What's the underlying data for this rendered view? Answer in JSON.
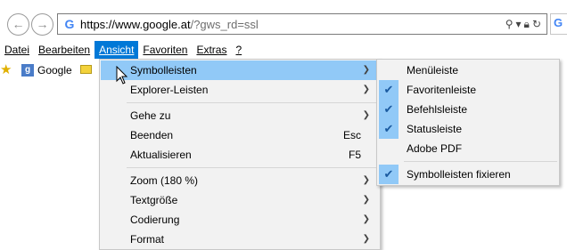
{
  "address_bar": {
    "url_host": "https://www.google.at",
    "url_path": "/?gws_rd=ssl",
    "icons": [
      "search-icon",
      "dropdown-icon",
      "lock-icon",
      "refresh-icon"
    ]
  },
  "nav": {
    "back_glyph": "←",
    "forward_glyph": "→"
  },
  "menubar": {
    "items": [
      "Datei",
      "Bearbeiten",
      "Ansicht",
      "Favoriten",
      "Extras",
      "?"
    ],
    "active": "Ansicht"
  },
  "favorites_bar": {
    "google_label": "Google"
  },
  "ansicht_menu": {
    "items": [
      {
        "label": "Symbolleisten",
        "shortcut": "",
        "submenu": true
      },
      {
        "label": "Explorer-Leisten",
        "shortcut": "",
        "submenu": true
      },
      {
        "label": "Gehe zu",
        "shortcut": "",
        "submenu": true
      },
      {
        "label": "Beenden",
        "shortcut": "Esc",
        "submenu": false
      },
      {
        "label": "Aktualisieren",
        "shortcut": "F5",
        "submenu": false
      },
      {
        "label": "Zoom (180 %)",
        "shortcut": "",
        "submenu": true
      },
      {
        "label": "Textgröße",
        "shortcut": "",
        "submenu": true
      },
      {
        "label": "Codierung",
        "shortcut": "",
        "submenu": true
      },
      {
        "label": "Format",
        "shortcut": "",
        "submenu": true
      }
    ]
  },
  "symbolleisten_submenu": {
    "items": [
      {
        "label": "Menüleiste",
        "checked": false
      },
      {
        "label": "Favoritenleiste",
        "checked": true
      },
      {
        "label": "Befehlsleiste",
        "checked": true
      },
      {
        "label": "Statusleiste",
        "checked": true
      },
      {
        "label": "Adobe PDF",
        "checked": false
      },
      {
        "label": "Symbolleisten fixieren",
        "checked": true
      }
    ]
  },
  "colors": {
    "menu_highlight": "#91c9f7",
    "menubar_active": "#0078d7"
  }
}
